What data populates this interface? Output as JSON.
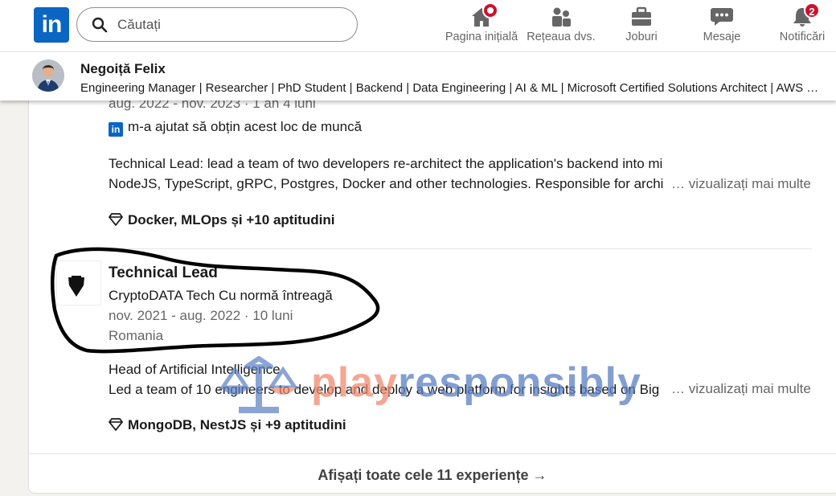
{
  "nav": {
    "search_placeholder": "Căutați",
    "items": [
      {
        "label": "Pagina inițială",
        "icon": "home-icon"
      },
      {
        "label": "Rețeaua dvs.",
        "icon": "network-icon"
      },
      {
        "label": "Joburi",
        "icon": "jobs-icon"
      },
      {
        "label": "Mesaje",
        "icon": "messaging-icon"
      },
      {
        "label": "Notificări",
        "icon": "bell-icon",
        "badge": "2"
      }
    ]
  },
  "profile": {
    "name": "Negoiță Felix",
    "headline": "Engineering Manager | Researcher | PhD Student | Backend | Data Engineering | AI & ML | Microsoft Certified Solutions Architect | AWS Certified"
  },
  "experience": {
    "prev": {
      "dates": "aug. 2022 - nov. 2023 · 1 an 4 luni",
      "linkedin_note": "m-a ajutat să obțin acest loc de muncă",
      "desc_line1": "Technical Lead: lead a team of two developers re-architect the application's backend into microservices, using",
      "desc_line2": "NodeJS, TypeScript, gRPC, Postgres, Docker and other technologies. Responsible for architecture",
      "more": "… vizualizați mai multe",
      "skills": "Docker, MLOps și +10 aptitudini"
    },
    "current": {
      "title": "Technical Lead",
      "company": "CryptoDATA Tech Cu normă întreagă",
      "dates": "nov. 2021 - aug. 2022 · 10 luni",
      "location": "Romania",
      "desc_line1": "Head of Artificial Intelligence",
      "desc_line2": "Led a team of 10 engineers to develop and deploy a web platform for insights based on Big Data",
      "more": "… vizualizați mai multe",
      "skills": "MongoDB, NestJS și +9 aptitudini"
    },
    "show_all": "Afișați toate cele 11 experiențe →"
  },
  "watermark": {
    "part1": "play",
    "part2": "responsibly"
  },
  "colors": {
    "brand": "#0a66c2",
    "badge": "#cb112d",
    "annotation": "#000000"
  }
}
